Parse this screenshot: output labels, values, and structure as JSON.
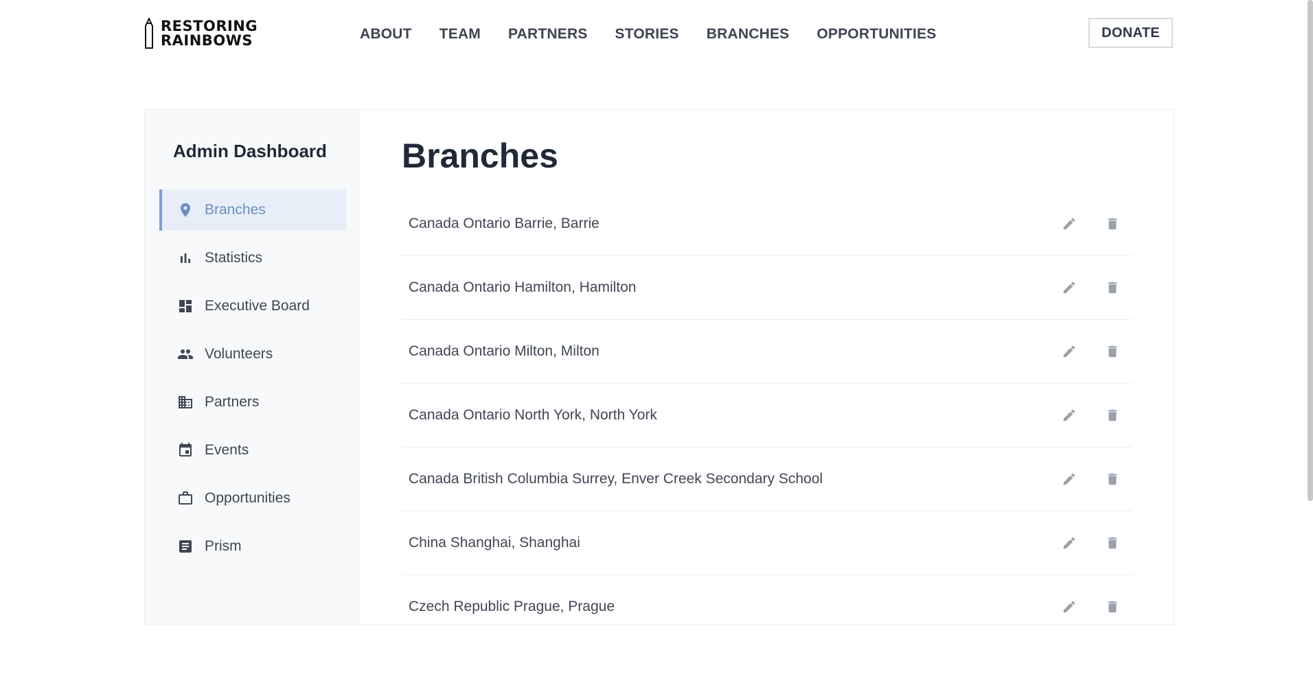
{
  "brand": {
    "line1": "RESTORING",
    "line2": "RAINBOWS"
  },
  "nav": [
    "ABOUT",
    "TEAM",
    "PARTNERS",
    "STORIES",
    "BRANCHES",
    "OPPORTUNITIES"
  ],
  "donate_label": "DONATE",
  "sidebar": {
    "title": "Admin Dashboard",
    "items": [
      {
        "label": "Branches",
        "icon": "location-pin-icon",
        "active": true
      },
      {
        "label": "Statistics",
        "icon": "bar-chart-icon",
        "active": false
      },
      {
        "label": "Executive Board",
        "icon": "dashboard-icon",
        "active": false
      },
      {
        "label": "Volunteers",
        "icon": "people-icon",
        "active": false
      },
      {
        "label": "Partners",
        "icon": "building-icon",
        "active": false
      },
      {
        "label": "Events",
        "icon": "calendar-icon",
        "active": false
      },
      {
        "label": "Opportunities",
        "icon": "briefcase-icon",
        "active": false
      },
      {
        "label": "Prism",
        "icon": "article-icon",
        "active": false
      }
    ]
  },
  "main": {
    "title": "Branches",
    "branches": [
      "Canada Ontario Barrie, Barrie",
      "Canada Ontario Hamilton, Hamilton",
      "Canada Ontario Milton, Milton",
      "Canada Ontario North York, North York",
      "Canada British Columbia Surrey, Enver Creek Secondary School",
      "China Shanghai, Shanghai",
      "Czech Republic Prague, Prague"
    ]
  },
  "colors": {
    "accent": "#6b8fc7",
    "active_bg": "#e7eef7",
    "sidebar_bg": "#f7f9fb",
    "icon_gray": "#9aa1ab"
  }
}
